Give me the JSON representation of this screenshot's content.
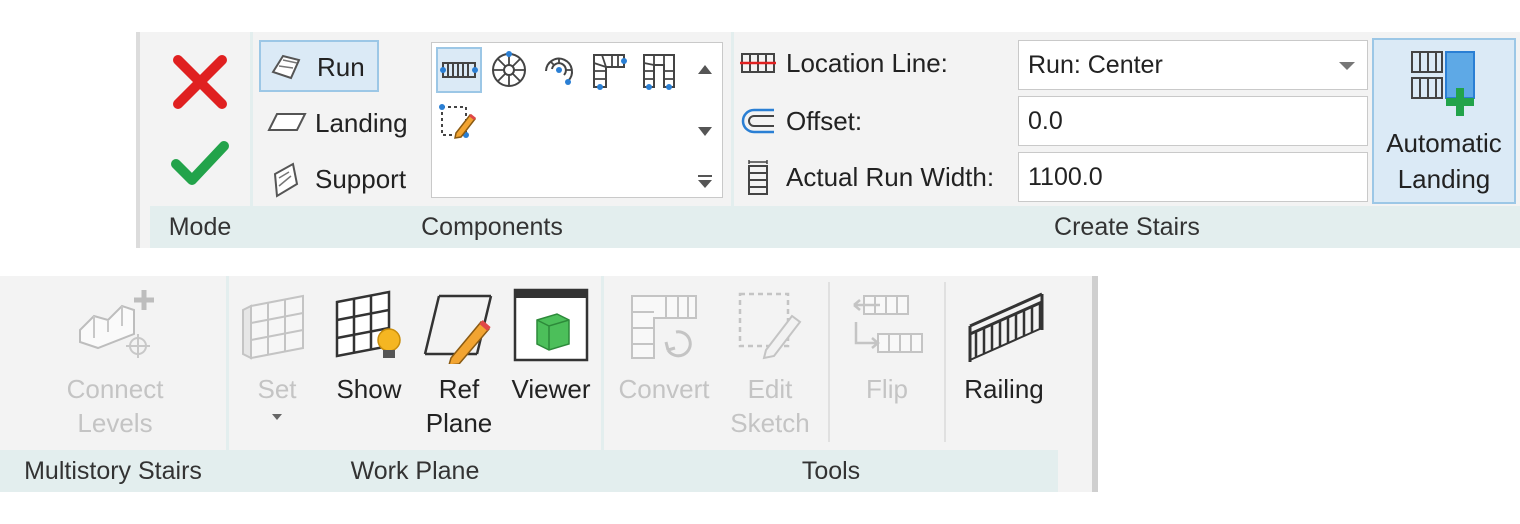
{
  "top_ribbon": {
    "mode": {
      "title": "Mode",
      "cancel_icon": "x-cancel-icon",
      "finish_icon": "check-finish-icon"
    },
    "components": {
      "title": "Components",
      "run": "Run",
      "landing": "Landing",
      "support": "Support",
      "gallery_icons": [
        "straight-run-icon",
        "spiral-run-icon",
        "center-ends-spiral-icon",
        "l-winder-icon",
        "u-winder-icon",
        "sketch-run-icon"
      ]
    },
    "create_stairs": {
      "title": "Create Stairs",
      "location_line_label": "Location Line:",
      "location_line_value": "Run: Center",
      "offset_label": "Offset:",
      "offset_value": "0.0",
      "run_width_label": "Actual Run Width:",
      "run_width_value": "1100.0",
      "auto_landing_line1": "Automatic",
      "auto_landing_line2": "Landing"
    }
  },
  "bottom_ribbon": {
    "multistory": {
      "title": "Multistory Stairs",
      "connect_line1": "Connect",
      "connect_line2": "Levels"
    },
    "work_plane": {
      "title": "Work Plane",
      "set": "Set",
      "show": "Show",
      "ref_line1": "Ref",
      "ref_line2": "Plane",
      "viewer": "Viewer"
    },
    "tools": {
      "title": "Tools",
      "convert": "Convert",
      "edit_line1": "Edit",
      "edit_line2": "Sketch",
      "flip": "Flip",
      "railing": "Railing"
    }
  },
  "colors": {
    "accent_blue": "#2a7fd4",
    "cancel_red": "#e02020",
    "finish_green": "#22a34a",
    "panel_title_bg": "#e3eeee"
  }
}
